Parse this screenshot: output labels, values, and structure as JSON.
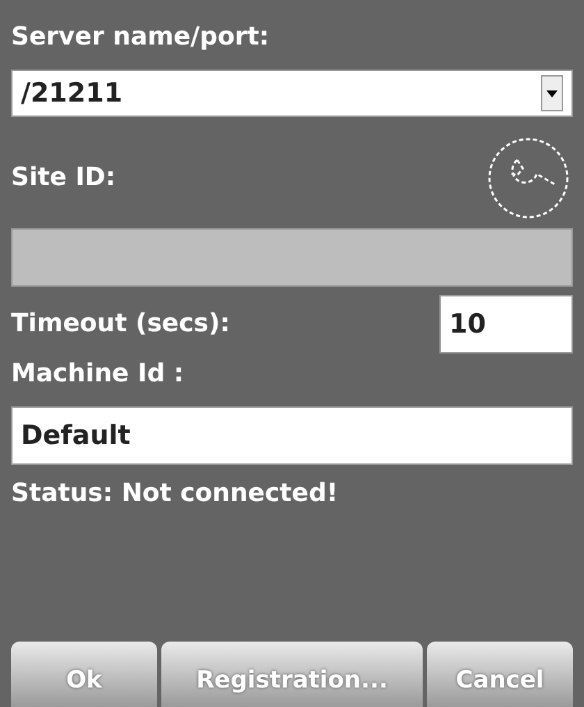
{
  "server": {
    "label": "Server name/port:",
    "value": "/21211"
  },
  "site_id": {
    "label": "Site ID:",
    "disabled": true
  },
  "timeout": {
    "label": "Timeout (secs):",
    "value": "10"
  },
  "machine_id": {
    "label": "Machine Id :",
    "value": "Default"
  },
  "status": "Status: Not connected!",
  "buttons": [
    "Ok",
    "Registration...",
    "Cancel"
  ]
}
